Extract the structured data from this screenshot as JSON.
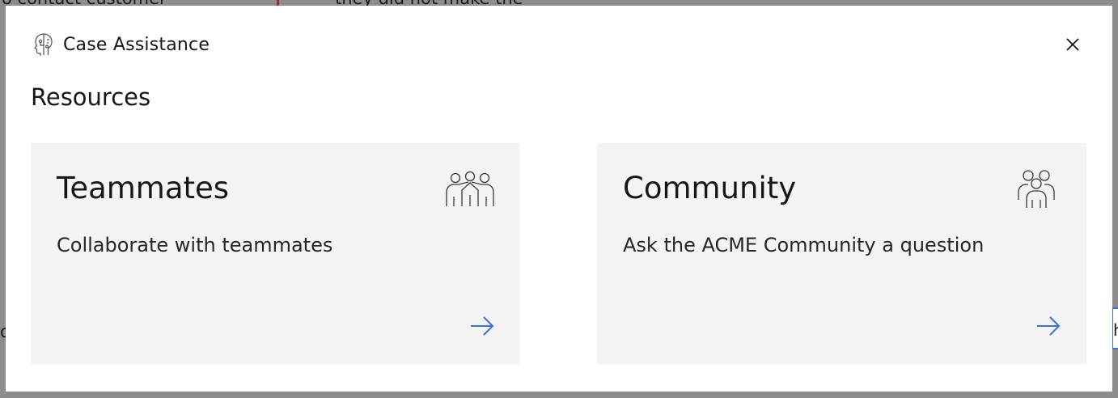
{
  "background": {
    "fragment_left": "o contact customer",
    "fragment_right": "they did not make the",
    "edge_left": "d",
    "edge_right": "h"
  },
  "modal": {
    "header": {
      "icon": "ai-head-icon",
      "title": "Case Assistance"
    },
    "close_icon": "close-icon",
    "section_title": "Resources",
    "cards": [
      {
        "title": "Teammates",
        "description": "Collaborate with teammates",
        "icon": "teammates-icon",
        "arrow_icon": "arrow-right-icon"
      },
      {
        "title": "Community",
        "description": "Ask the ACME Community a question",
        "icon": "community-icon",
        "arrow_icon": "arrow-right-icon"
      }
    ]
  },
  "colors": {
    "overlay": "#8d8d8d",
    "card_background": "#f4f4f4",
    "arrow": "#3d6fd8",
    "text": "#161616"
  }
}
